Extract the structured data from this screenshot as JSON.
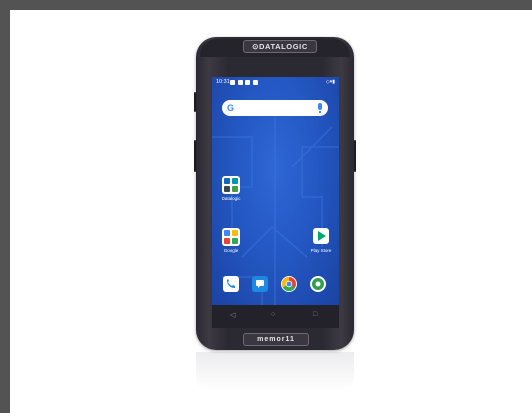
{
  "device": {
    "brand_text": "⊙DATALOGIC",
    "chin_text": "memor11"
  },
  "status_bar": {
    "time": "10:31",
    "right_icons": "◇▾▮"
  },
  "search_bar": {
    "logo_text": "G"
  },
  "home": {
    "folders": [
      {
        "label": "Datalogic"
      },
      {
        "label": "Google"
      }
    ],
    "apps": [
      {
        "label": "Play Store"
      }
    ],
    "dock": [
      "phone",
      "messages",
      "chrome",
      "camera"
    ]
  },
  "navigation": {
    "back": "◁",
    "home": "○",
    "recents": "□"
  },
  "colors": {
    "wallpaper": "#2458c3",
    "frame_bg": "#535353"
  }
}
